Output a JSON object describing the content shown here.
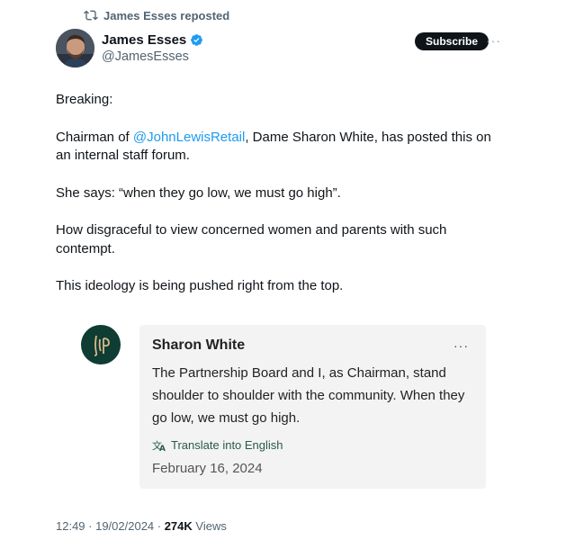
{
  "repost": {
    "label": "James Esses reposted"
  },
  "author": {
    "name": "James Esses",
    "handle": "@JamesEsses"
  },
  "actions": {
    "subscribe_label": "Subscribe",
    "more_label": "···"
  },
  "tweet": {
    "p1": "Breaking:",
    "p2_before": "Chairman of ",
    "p2_mention": "@JohnLewisRetail",
    "p2_after": ", Dame Sharon White, has posted this on an internal staff forum.",
    "p3": "She says: “when they go low, we must go high”.",
    "p4": "How disgraceful to view concerned women and parents with such contempt.",
    "p5": "This ideology is being pushed right from the top."
  },
  "embed": {
    "name": "Sharon White",
    "more_label": "···",
    "text": "The Partnership Board and I, as Chairman, stand shoulder to shoulder with the community. When they go low, we must go high.",
    "translate_label": "Translate into English",
    "date": "February 16, 2024"
  },
  "meta": {
    "time_date": "12:49 · 19/02/2024 · ",
    "views_count": "274K",
    "views_label": " Views"
  },
  "colors": {
    "accent": "#1d9bf0",
    "logo_bg": "#0f3c33",
    "card_bg": "#f3f3f3"
  }
}
